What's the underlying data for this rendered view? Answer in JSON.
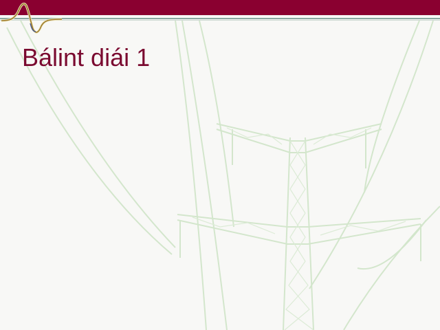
{
  "slide": {
    "title": "Bálint diái 1"
  },
  "colors": {
    "brand_band": "#8a0030",
    "title_text": "#7a0a30",
    "tower_lines": "#cfe3c8",
    "wave_logo": "#9c7a2a"
  },
  "icons": {
    "logo": "waveform-logo-icon",
    "background": "power-pylon-illustration"
  }
}
